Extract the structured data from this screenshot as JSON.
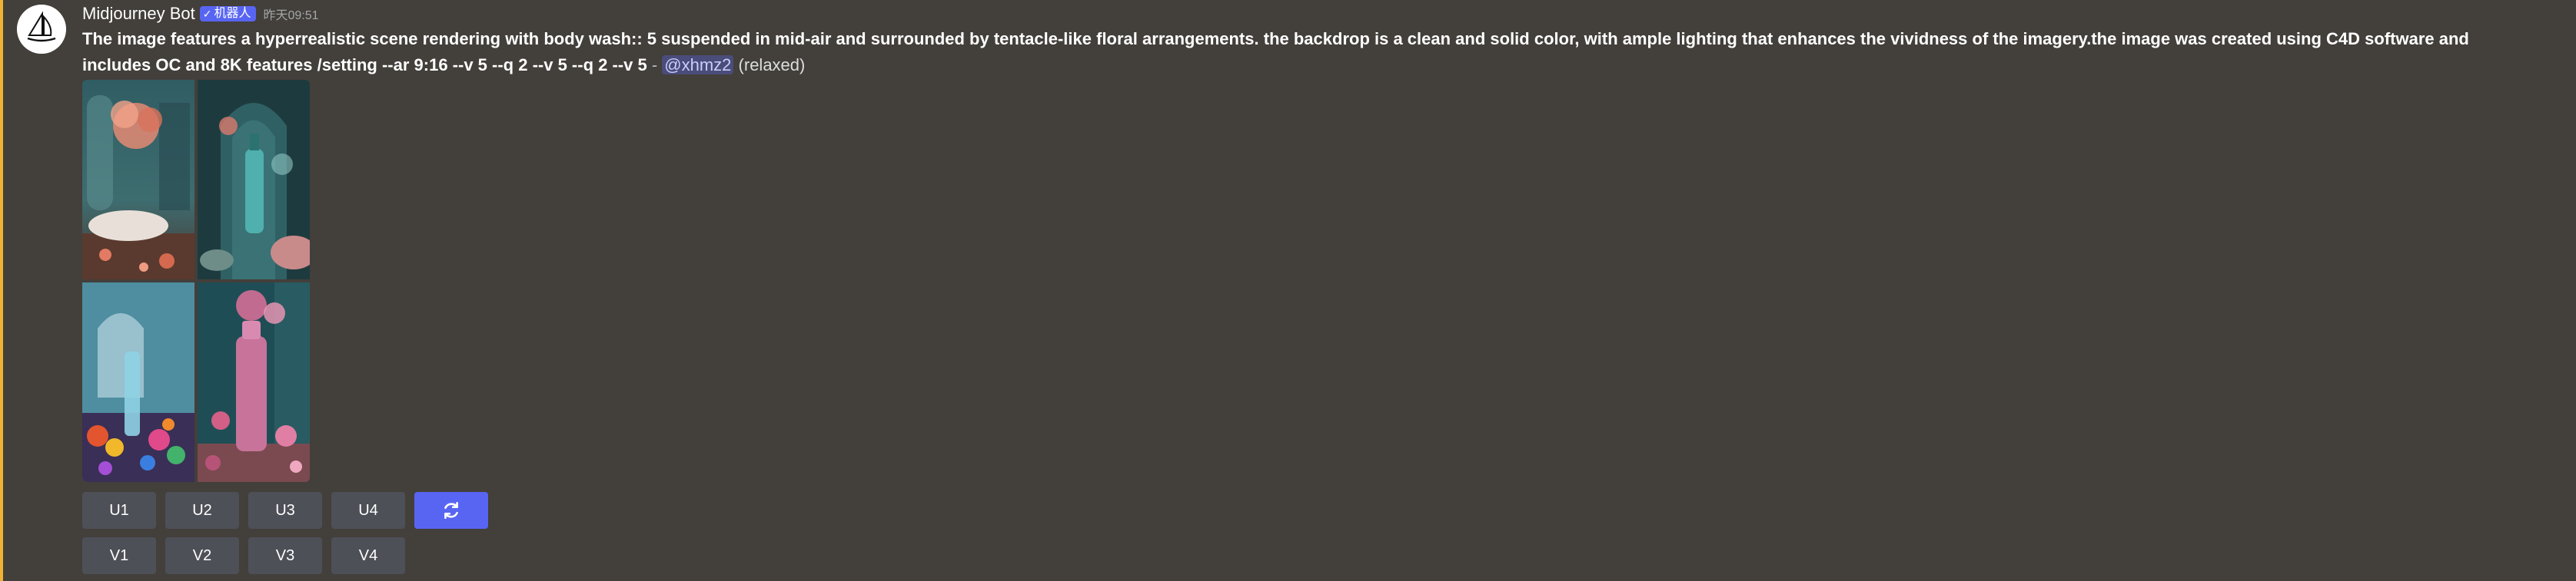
{
  "author": {
    "name": "Midjourney Bot",
    "bot_tag": "机器人",
    "timestamp": "昨天09:51",
    "avatar_icon": "sailboat-icon"
  },
  "message": {
    "prompt": "The image features a hyperrealistic scene rendering with body wash:: 5 suspended in mid-air and surrounded by tentacle-like floral arrangements. the backdrop is a clean and solid color, with ample lighting that enhances the vividness of the imagery.the image was created using C4D software and includes OC and 8K features /setting --ar 9:16 --v 5 --q 2 --v 5 --q 2 --v 5",
    "separator": " - ",
    "mention": "@xhmz2",
    "status": "(relaxed)"
  },
  "buttons": {
    "upscale": [
      "U1",
      "U2",
      "U3",
      "U4"
    ],
    "variation": [
      "V1",
      "V2",
      "V3",
      "V4"
    ],
    "reroll_icon": "refresh-icon"
  },
  "colors": {
    "background": "#433f3b",
    "accent_bar": "#f0b232",
    "button": "#4e5058",
    "primary_button": "#5865f2"
  }
}
